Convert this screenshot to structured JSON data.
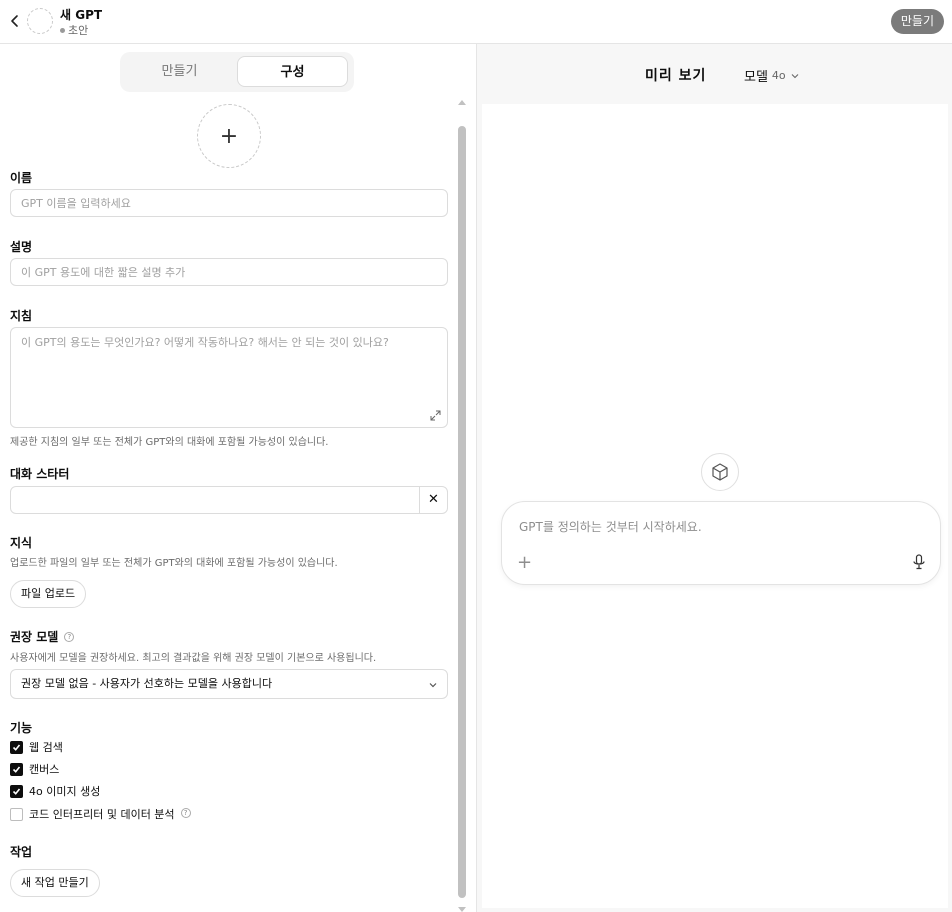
{
  "header": {
    "title": "새 GPT",
    "status": "초안",
    "create_button": "만들기"
  },
  "tabs": [
    {
      "label": "만들기",
      "active": false
    },
    {
      "label": "구성",
      "active": true
    }
  ],
  "form": {
    "name": {
      "label": "이름",
      "placeholder": "GPT 이름을 입력하세요"
    },
    "description": {
      "label": "설명",
      "placeholder": "이 GPT 용도에 대한 짧은 설명 추가"
    },
    "instructions": {
      "label": "지침",
      "placeholder": "이 GPT의 용도는 무엇인가요? 어떻게 작동하나요? 해서는 안 되는 것이 있나요?",
      "help": "제공한 지침의 일부 또는 전체가 GPT와의 대화에 포함될 가능성이 있습니다."
    },
    "conversation_starters": {
      "label": "대화 스타터",
      "value": ""
    },
    "knowledge": {
      "label": "지식",
      "help": "업로드한 파일의 일부 또는 전체가 GPT와의 대화에 포함될 가능성이 있습니다.",
      "upload_button": "파일 업로드"
    },
    "recommended_model": {
      "label": "권장 모델",
      "help": "사용자에게 모델을 권장하세요. 최고의 결과값을 위해 권장 모델이 기본으로 사용됩니다.",
      "selected": "권장 모델 없음 - 사용자가 선호하는 모델을 사용합니다"
    },
    "capabilities": {
      "label": "기능",
      "items": [
        {
          "label": "웹 검색",
          "checked": true
        },
        {
          "label": "캔버스",
          "checked": true
        },
        {
          "label": "4o 이미지 생성",
          "checked": true
        },
        {
          "label": "코드 인터프리터 및 데이터 분석",
          "checked": false
        }
      ]
    },
    "actions": {
      "label": "작업",
      "new_button": "새 작업 만들기"
    }
  },
  "preview": {
    "title": "미리 보기",
    "model_label": "모델",
    "model_version": "4o",
    "composer_placeholder": "GPT를 정의하는 것부터 시작하세요."
  }
}
